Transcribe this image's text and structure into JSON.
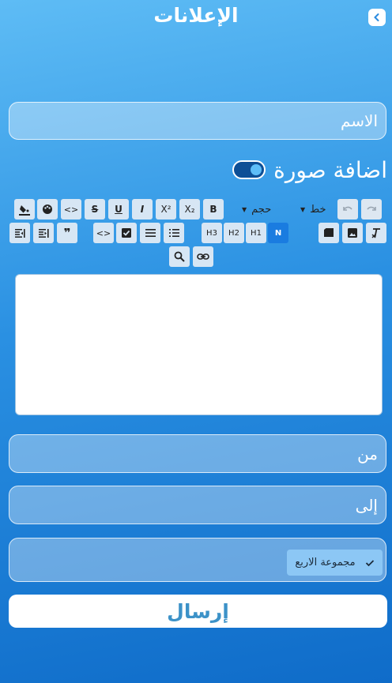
{
  "header": {
    "title": "الإعلانات",
    "back_icon": "chevron-left-icon"
  },
  "form": {
    "name_label": "الاسم",
    "add_image_label": "اضافة صورة",
    "add_image_enabled": true,
    "from_label": "من",
    "to_label": "إلى",
    "group_chip": "مجموعة الاربع",
    "submit_label": "إرسال"
  },
  "toolbar": {
    "font_label": "خط",
    "size_label": "حجم",
    "bold": "B",
    "subscript": "X₂",
    "superscript": "X²",
    "italic": "I",
    "underline": "U",
    "strike": "S",
    "code": "<>",
    "code_block": "<>",
    "quote": "❞",
    "normal": "N",
    "h1": "H1",
    "h2": "H2",
    "h3": "H3"
  },
  "colors": {
    "accent": "#1a7ce0",
    "toolbar_button": "#d7e6f4"
  }
}
